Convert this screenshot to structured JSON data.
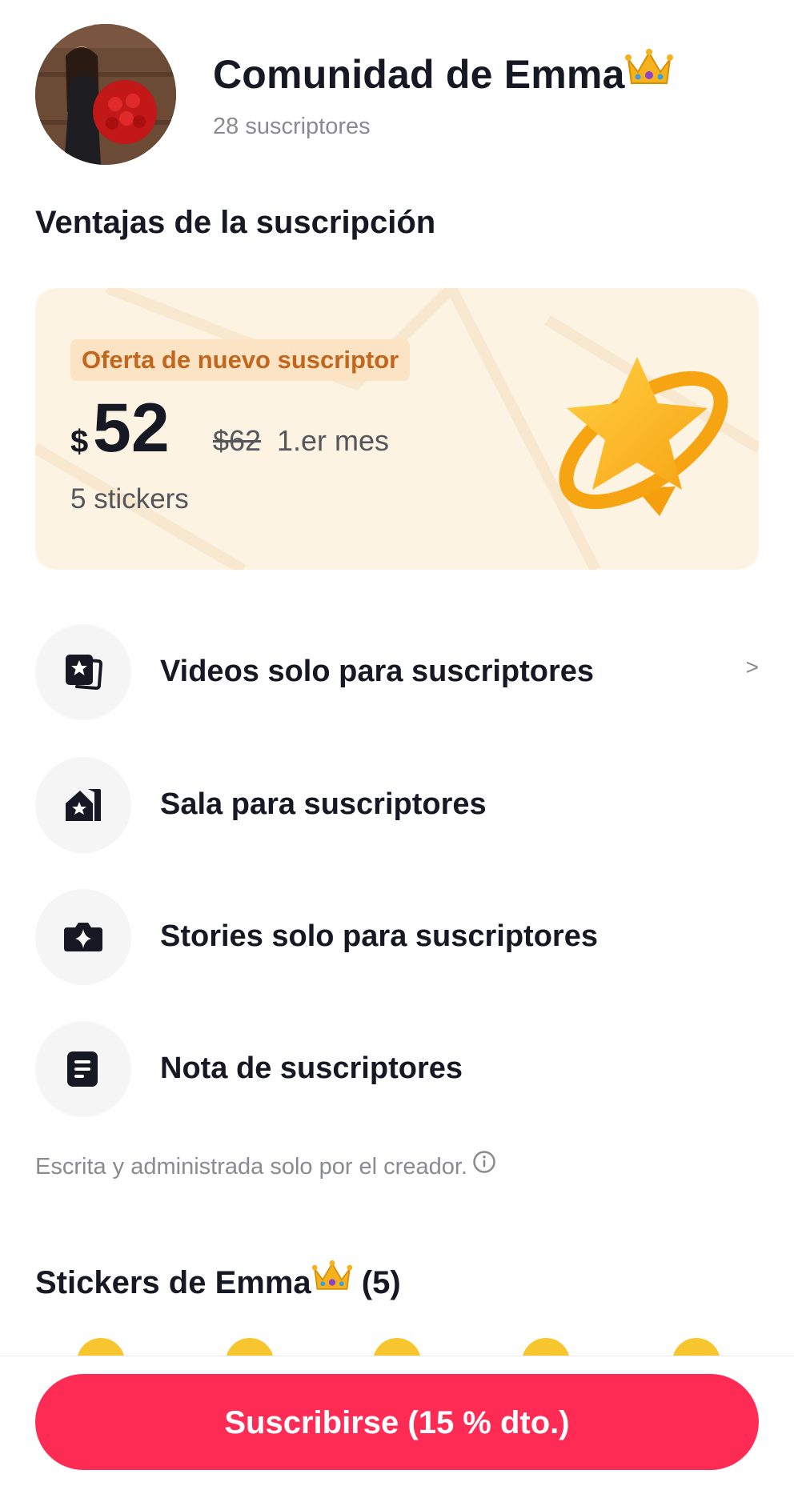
{
  "header": {
    "community_name": "Comunidad de Emma",
    "community_emoji": "crown-icon",
    "subscriber_count": "28 suscriptores"
  },
  "benefits_section": {
    "title": "Ventajas de la suscripción"
  },
  "offer": {
    "badge": "Oferta de nuevo suscriptor",
    "currency": "$",
    "price": "52",
    "old_price": "$62",
    "period": "1.er mes",
    "stickers": "5 stickers",
    "accent_color": "#fdf3e3"
  },
  "benefits": [
    {
      "label": "Videos solo para suscriptores",
      "icon": "video-star-icon",
      "chevron": ">"
    },
    {
      "label": "Sala para suscriptores",
      "icon": "house-star-icon"
    },
    {
      "label": "Stories solo para suscriptores",
      "icon": "camera-sparkle-icon"
    },
    {
      "label": "Nota de suscriptores",
      "icon": "note-icon"
    }
  ],
  "footnote": "Escrita y administrada solo por el creador.",
  "stickers": {
    "title_prefix": "Stickers de Emma",
    "title_suffix": " (5)"
  },
  "cta": {
    "subscribe_label": "Suscribirse (15 % dto.)",
    "color": "#fe2c55"
  }
}
